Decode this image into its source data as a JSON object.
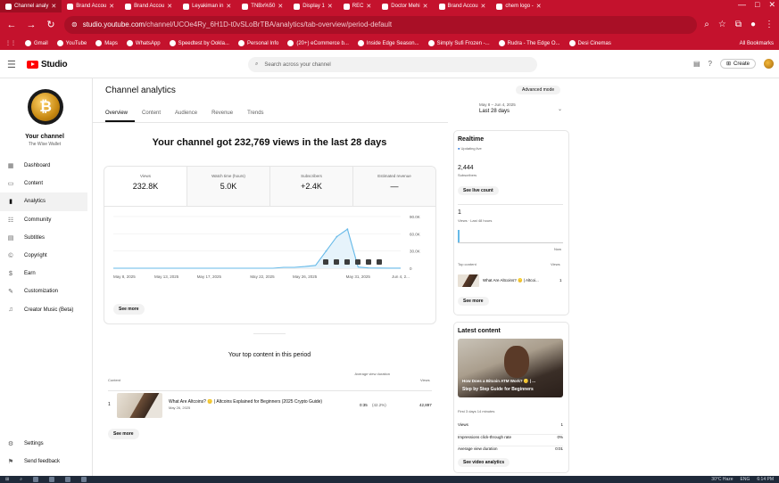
{
  "browser": {
    "tabs": [
      {
        "label": "Channel analy",
        "active": true
      },
      {
        "label": "Brand Accou",
        "active": false
      },
      {
        "label": "Brand Accou",
        "active": false
      },
      {
        "label": "Leyakiman in",
        "active": false
      },
      {
        "label": "TNBx%50",
        "active": false
      },
      {
        "label": "Display 1",
        "active": false
      },
      {
        "label": "REC",
        "active": false
      },
      {
        "label": "Doctor Mehi",
        "active": false
      },
      {
        "label": "Brand Accou",
        "active": false
      },
      {
        "label": "chem logo -",
        "active": false
      }
    ],
    "url_host": "studio.youtube.com",
    "url_path": "/channel/UCOe4Ry_6H1D-t0vSLoBrTBA/analytics/tab-overview/period-default",
    "bookmarks": [
      "Gmail",
      "YouTube",
      "Maps",
      "WhatsApp",
      "Speedtest by Ookla...",
      "Personal Info",
      "(20+) eCommerce b...",
      "Inside Edge Season...",
      "Simply Sufi Frozen -...",
      "Rudra - The Edge O...",
      "Desi Cinemas"
    ],
    "all_bookmarks": "All Bookmarks"
  },
  "header": {
    "logo_text": "Studio",
    "search_placeholder": "Search across your channel",
    "create_label": "Create"
  },
  "sidebar": {
    "channel_title": "Your channel",
    "channel_name": "The Wise Wallet",
    "items": [
      {
        "label": "Dashboard",
        "icon": "dashboard-icon",
        "active": false
      },
      {
        "label": "Content",
        "icon": "content-icon",
        "active": false
      },
      {
        "label": "Analytics",
        "icon": "analytics-icon",
        "active": true
      },
      {
        "label": "Community",
        "icon": "community-icon",
        "active": false
      },
      {
        "label": "Subtitles",
        "icon": "subtitles-icon",
        "active": false
      },
      {
        "label": "Copyright",
        "icon": "copyright-icon",
        "active": false
      },
      {
        "label": "Earn",
        "icon": "earn-icon",
        "active": false
      },
      {
        "label": "Customization",
        "icon": "customization-icon",
        "active": false
      },
      {
        "label": "Creator Music (Beta)",
        "icon": "music-icon",
        "active": false
      }
    ],
    "bottom": [
      {
        "label": "Settings",
        "icon": "gear-icon"
      },
      {
        "label": "Send feedback",
        "icon": "feedback-icon"
      }
    ]
  },
  "main": {
    "title": "Channel analytics",
    "advanced_mode": "Advanced mode",
    "tabs": [
      "Overview",
      "Content",
      "Audience",
      "Revenue",
      "Trends"
    ],
    "date_range_dates": "May 8 – Jun 4, 2025",
    "date_range_label": "Last 28 days",
    "headline": "Your channel got 232,769 views in the last 28 days",
    "metrics": [
      {
        "label": "Views",
        "value": "232.8K"
      },
      {
        "label": "Watch time (hours)",
        "value": "5.0K"
      },
      {
        "label": "Subscribers",
        "value": "+2.4K"
      },
      {
        "label": "Estimated revenue",
        "value": "—"
      }
    ],
    "see_more": "See more",
    "top_content_title": "Your top content in this period",
    "table_headers": {
      "content": "Content",
      "avg_duration": "Average view duration",
      "views": "Views"
    },
    "top_content_rows": [
      {
        "index": "1",
        "title": "What Are Altcoins? 🪙 | Altcoins Explained for Beginners (2025 Crypto Guide)",
        "date": "May 26, 2025",
        "avg_duration": "0:35",
        "avg_pct": "(42.2%)",
        "views": "42,897"
      }
    ],
    "table_see_more": "See more"
  },
  "chart_data": {
    "type": "line",
    "x": [
      "May 8",
      "May 9",
      "May 10",
      "May 11",
      "May 12",
      "May 13",
      "May 14",
      "May 15",
      "May 16",
      "May 17",
      "May 18",
      "May 19",
      "May 20",
      "May 21",
      "May 22",
      "May 23",
      "May 24",
      "May 25",
      "May 26",
      "May 27",
      "May 28",
      "May 29",
      "May 30",
      "May 31",
      "Jun 1",
      "Jun 2",
      "Jun 3",
      "Jun 4"
    ],
    "series": [
      {
        "values": [
          0,
          0,
          0,
          0,
          0,
          0,
          0,
          0,
          0,
          0,
          0,
          0,
          0,
          0,
          0,
          0,
          1500,
          1500,
          3000,
          5000,
          30000,
          55000,
          68000,
          2000,
          500,
          300,
          200,
          200
        ]
      }
    ],
    "x_tick_labels": [
      "May 8, 2025",
      "May 13, 2025",
      "May 17, 2025",
      "May 22, 2025",
      "May 26, 2025",
      "May 31, 2025",
      "Jun 4, 2..."
    ],
    "y_tick_labels": [
      "0",
      "30.0K",
      "60.0K",
      "90.0K"
    ],
    "ylim": [
      0,
      90000
    ],
    "grid": true
  },
  "realtime": {
    "title": "Realtime",
    "status": "Updating live",
    "subscribers_value": "2,444",
    "subscribers_label": "Subscribers",
    "see_live_count": "See live count",
    "views_value": "1",
    "views_label": "Views · Last 48 hours",
    "now_label": "Now",
    "top_content_label": "Top content",
    "views_col": "Views",
    "top_item_title": "What Are Altcoins? 🪙 | Altcoi...",
    "top_item_views": "1",
    "see_more": "See more"
  },
  "latest": {
    "title": "Latest content",
    "thumb_caption1": "How Does a Bitcoin ATM Work? 🪙 | ...",
    "thumb_caption2": "Step by Step Guide for Beginners",
    "age": "First 3 days 14 minutes",
    "stats": [
      {
        "label": "Views",
        "value": "1"
      },
      {
        "label": "Impressions click-through rate",
        "value": "0%"
      },
      {
        "label": "Average view duration",
        "value": "0:01"
      }
    ],
    "see_analytics": "See video analytics"
  },
  "taskbar": {
    "weather": "30°C Haze",
    "lang": "ENG",
    "time": "6:14 PM"
  },
  "colors": {
    "accent": "#065fd4",
    "chrome_red": "#c4122d",
    "chart_line": "#65b9e8"
  }
}
